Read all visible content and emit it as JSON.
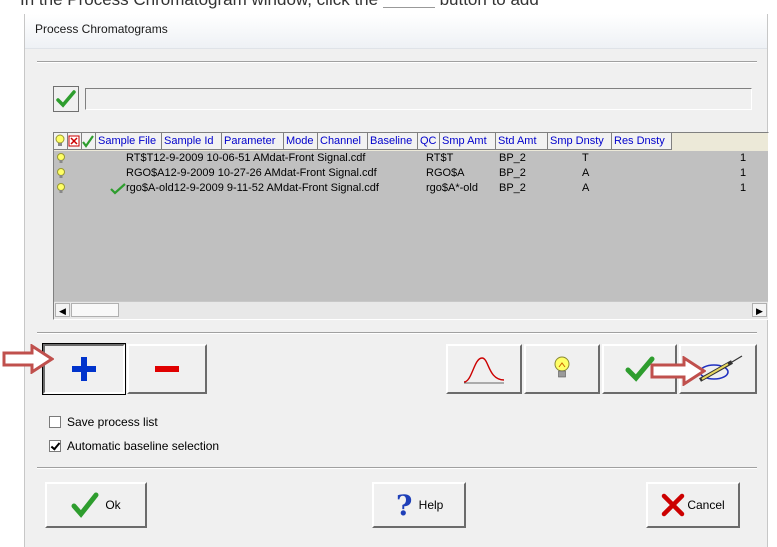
{
  "instruction": {
    "prefix": "In the Process Chromatogram window, click the",
    "suffix": "button to add"
  },
  "window": {
    "title": "Process Chromatograms"
  },
  "grid": {
    "columns": [
      "Sample File",
      "Sample Id",
      "Parameter",
      "Mode",
      "Channel",
      "Baseline",
      "QC",
      "Smp Amt",
      "Std Amt",
      "Smp Dnsty",
      "Res Dnsty"
    ],
    "rows": [
      {
        "sample_file": "RT$T12-9-2009 10-06-51 AMdat-Front Signal.cdf",
        "baseline": "RT$T",
        "qc": "BP_2",
        "std_amt": "T",
        "res_dnsty": "1",
        "checked": false
      },
      {
        "sample_file": "RGO$A12-9-2009 10-27-26 AMdat-Front Signal.cdf",
        "baseline": "RGO$A",
        "qc": "BP_2",
        "std_amt": "A",
        "res_dnsty": "1",
        "checked": false
      },
      {
        "sample_file": "rgo$A-old12-9-2009 9-11-52 AMdat-Front Signal.cdf",
        "baseline": "rgo$A*-old",
        "qc": "BP_2",
        "std_amt": "A",
        "res_dnsty": "1",
        "checked": true
      }
    ]
  },
  "options": {
    "save_process_list": {
      "label": "Save process list",
      "checked": false
    },
    "auto_baseline": {
      "label": "Automatic baseline selection",
      "checked": true
    }
  },
  "buttons": {
    "ok": "Ok",
    "help": "Help",
    "cancel": "Cancel"
  },
  "colors": {
    "arrow": "#c0504d",
    "plus": "#0033cc",
    "minus": "#e00000",
    "check": "#2e9d2e"
  }
}
